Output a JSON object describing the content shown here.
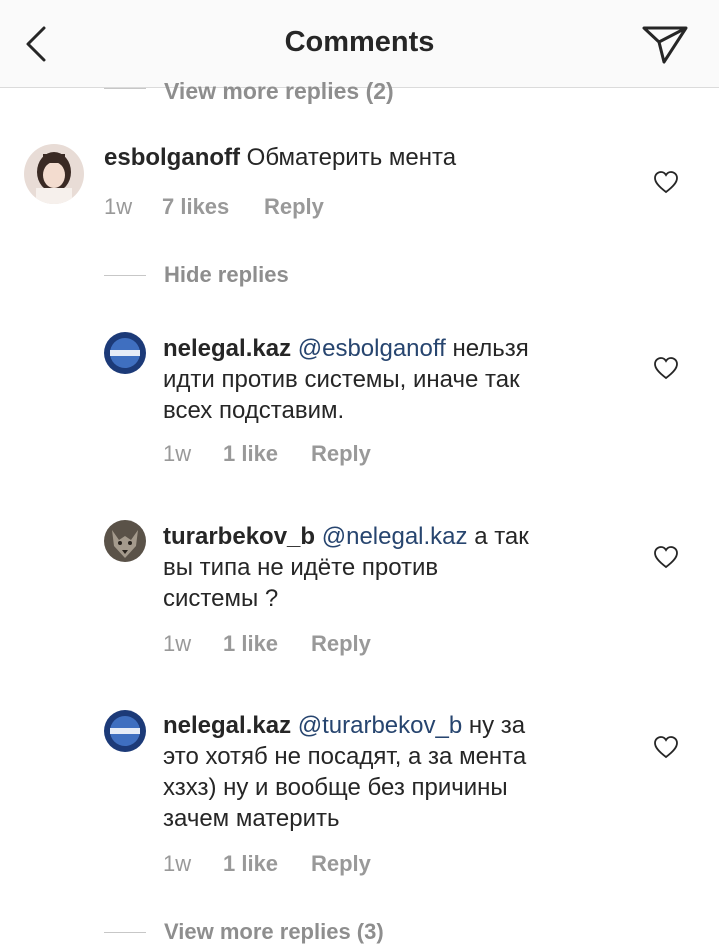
{
  "header": {
    "title": "Comments"
  },
  "top_cutoff": {
    "label": "View more replies (2)"
  },
  "main_comment": {
    "username": "esbolganoff",
    "text": "Обматерить мента",
    "time": "1w",
    "likes": "7 likes",
    "reply": "Reply"
  },
  "hide_replies": "Hide replies",
  "replies": [
    {
      "username": "nelegal.kaz",
      "mention": "@esbolganoff",
      "line1": "нельзя",
      "line2": "идти против системы, иначе так",
      "line3": "всех подставим.",
      "time": "1w",
      "likes": "1 like",
      "reply": "Reply"
    },
    {
      "username": "turarbekov_b",
      "mention": "@nelegal.kaz",
      "line1": "а так",
      "line2": "вы типа не идёте против",
      "line3": "системы ?",
      "time": "1w",
      "likes": "1 like",
      "reply": "Reply"
    },
    {
      "username": "nelegal.kaz",
      "mention": "@turarbekov_b",
      "line1": "ну за",
      "line2": "это хотяб не посадят, а за мента",
      "line3": "хзхз) ну и вообще без причины",
      "line4": "зачем материть",
      "time": "1w",
      "likes": "1 like",
      "reply": "Reply"
    }
  ],
  "view_more_replies": "View more replies (3)",
  "colors": {
    "mention": "#27456f",
    "meta": "#999999",
    "header_bg": "#fafafa"
  },
  "icons": [
    "back-arrow-icon",
    "send-icon",
    "heart-icon"
  ]
}
